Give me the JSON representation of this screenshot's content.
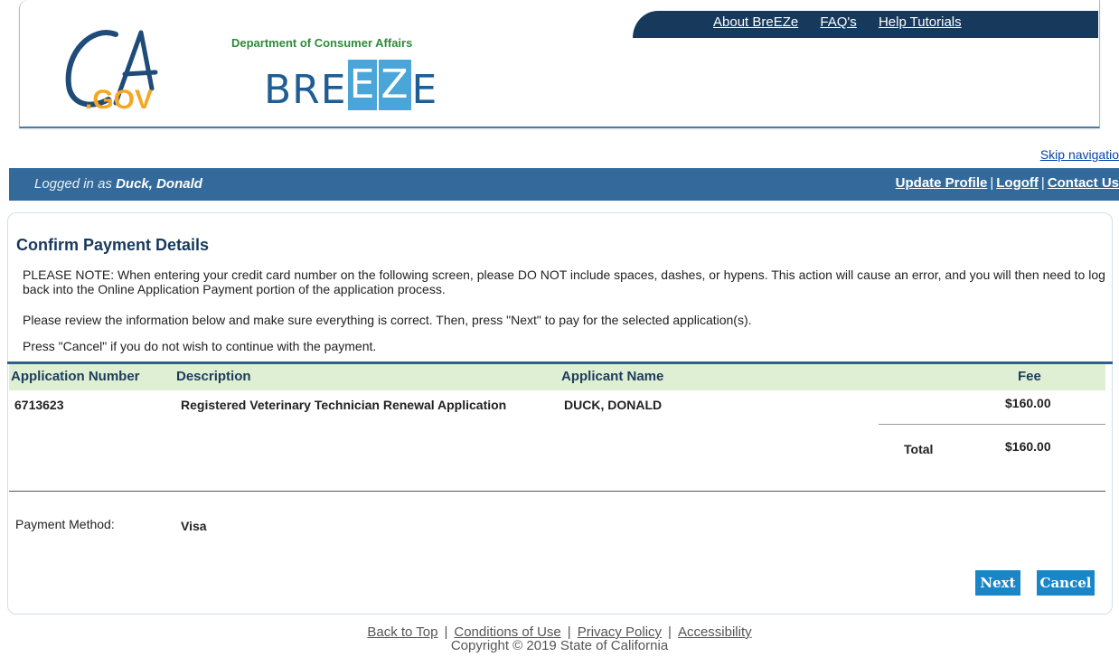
{
  "header": {
    "top_links": [
      "About BreEZe",
      "FAQ's",
      "Help Tutorials"
    ],
    "ca_logo_text": ".GOV",
    "department": "Department of Consumer Affairs",
    "breeze_logo": {
      "before": "BRE",
      "box1": "E",
      "box2": "Z",
      "after": "E"
    },
    "nav_color": "#17395c"
  },
  "skip_navigation": "Skip navigatio",
  "userbar": {
    "logged_in_prefix": "Logged in as",
    "user_name": "Duck, Donald",
    "links": [
      "Update Profile",
      "Logoff",
      "Contact Us"
    ],
    "separator": "|",
    "bar_color": "#336a9b"
  },
  "page": {
    "title": "Confirm Payment Details",
    "note1": "PLEASE NOTE: When entering your credit card number on the following screen, please DO NOT include spaces, dashes, or hypens. This action will cause an error, and you will then need to log back into the Online Application Payment portion of the application process.",
    "note2": "Please review the information below and make sure everything is correct. Then, press \"Next\" to pay for the selected application(s).",
    "note3": "Press \"Cancel\" if you do not wish to continue with the payment."
  },
  "table": {
    "headers": {
      "app_number": "Application Number",
      "description": "Description",
      "applicant": "Applicant Name",
      "fee": "Fee"
    },
    "rows": [
      {
        "app_number": "6713623",
        "description": "Registered Veterinary Technician Renewal Application",
        "applicant": "DUCK, DONALD",
        "fee": "$160.00"
      }
    ],
    "total_label": "Total",
    "total_value": "$160.00",
    "header_bg": "#deefd3"
  },
  "payment": {
    "label": "Payment Method:",
    "value": "Visa"
  },
  "buttons": {
    "next": "Next",
    "cancel": "Cancel",
    "color": "#1a86c8"
  },
  "footer": {
    "links": [
      "Back to Top",
      "Conditions of Use",
      "Privacy Policy",
      "Accessibility"
    ],
    "separator": "|",
    "copyright": "Copyright © 2019 State of California"
  }
}
